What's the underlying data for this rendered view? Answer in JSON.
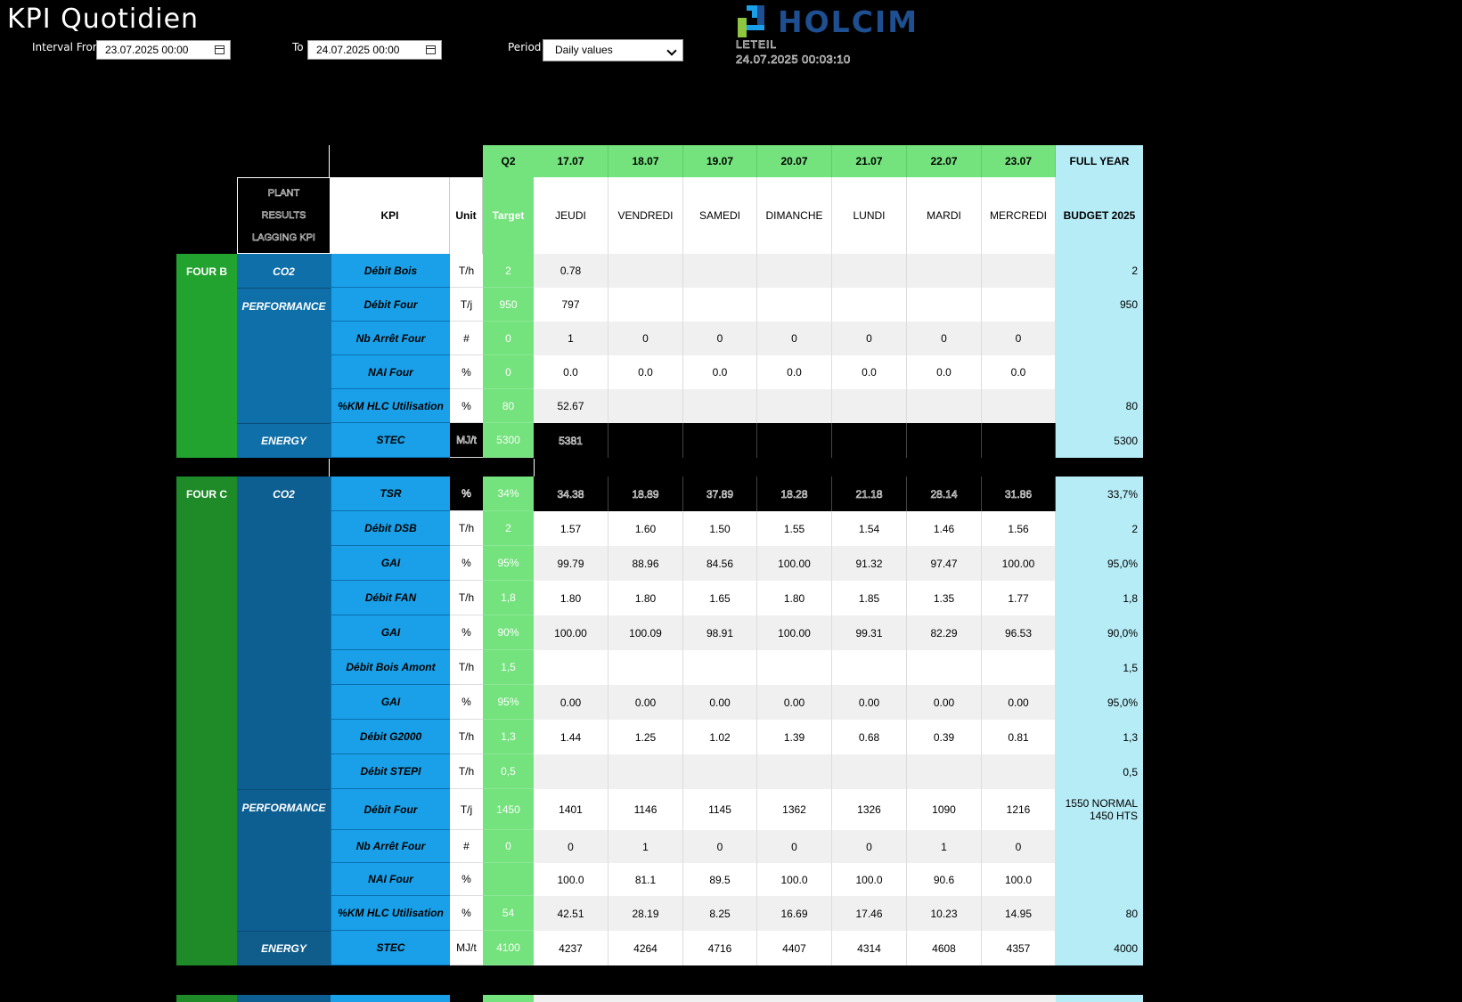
{
  "header": {
    "title": "KPI Quotidien",
    "interval_from_label": "Interval From",
    "interval_from_value": "23.07.2025 00:00",
    "to_label": "To",
    "to_value": "24.07.2025 00:00",
    "period_label": "Period",
    "period_value": "Daily values",
    "brand": "HOLCIM",
    "site": "LETEIL",
    "timestamp": "24.07.2025 00:03:10"
  },
  "table": {
    "top_headers": [
      "Q2",
      "17.07",
      "18.07",
      "19.07",
      "20.07",
      "21.07",
      "22.07",
      "23.07",
      "FULL YEAR"
    ],
    "plant_header": [
      "PLANT",
      "RESULTS",
      "LAGGING KPI"
    ],
    "kpi_header": "KPI",
    "unit_header": "Unit",
    "target_header": "Target",
    "day_names": [
      "JEUDI",
      "VENDREDI",
      "SAMEDI",
      "DIMANCHE",
      "LUNDI",
      "MARDI",
      "MERCREDI"
    ],
    "budget_header": "BUDGET 2025",
    "sections": [
      {
        "name": "FOUR B",
        "groups": [
          {
            "category": "CO2",
            "rows": [
              0
            ]
          },
          {
            "category": "PERFORMANCE",
            "rows": [
              1,
              2,
              3,
              4
            ]
          },
          {
            "category": "ENERGY",
            "rows": [
              5
            ]
          }
        ],
        "rows": [
          {
            "kpi": "Débit Bois",
            "unit": "T/h",
            "target": "2",
            "values": [
              "0.78",
              "",
              "",
              "",
              "",
              "",
              ""
            ],
            "budget": "2"
          },
          {
            "kpi": "Débit Four",
            "unit": "T/j",
            "target": "950",
            "values": [
              "797",
              "",
              "",
              "",
              "",
              "",
              ""
            ],
            "budget": "950"
          },
          {
            "kpi": "Nb Arrêt Four",
            "unit": "#",
            "target": "0",
            "values": [
              "1",
              "0",
              "0",
              "0",
              "0",
              "0",
              "0"
            ],
            "budget": ""
          },
          {
            "kpi": "NAI Four",
            "unit": "%",
            "target": "0",
            "values": [
              "0.0",
              "0.0",
              "0.0",
              "0.0",
              "0.0",
              "0.0",
              "0.0"
            ],
            "budget": ""
          },
          {
            "kpi": "%KM  HLC Utilisation",
            "unit": "%",
            "target": "80",
            "values": [
              "52.67",
              "",
              "",
              "",
              "",
              "",
              ""
            ],
            "budget": "80"
          },
          {
            "kpi": "STEC",
            "unit": "MJ/t",
            "target": "5300",
            "values": [
              "5381",
              "",
              "",
              "",
              "",
              "",
              ""
            ],
            "budget": "5300",
            "dark": true
          }
        ]
      },
      {
        "name": "FOUR C",
        "groups": [
          {
            "category": "CO2",
            "rows": [
              0,
              1,
              2,
              3,
              4,
              5,
              6,
              7,
              8
            ]
          },
          {
            "category": "PERFORMANCE",
            "rows": [
              9,
              10,
              11,
              12
            ]
          },
          {
            "category": "ENERGY",
            "rows": [
              13
            ]
          }
        ],
        "rows": [
          {
            "kpi": "TSR",
            "unit": "%",
            "target": "34%",
            "values": [
              "34.38",
              "18.89",
              "37.89",
              "18.28",
              "21.18",
              "28.14",
              "31.86"
            ],
            "budget": "33,7%",
            "dark": true
          },
          {
            "kpi": "Débit DSB",
            "unit": "T/h",
            "target": "2",
            "values": [
              "1.57",
              "1.60",
              "1.50",
              "1.55",
              "1.54",
              "1.46",
              "1.56"
            ],
            "budget": "2"
          },
          {
            "kpi": "GAI",
            "unit": "%",
            "target": "95%",
            "values": [
              "99.79",
              "88.96",
              "84.56",
              "100.00",
              "91.32",
              "97.47",
              "100.00"
            ],
            "budget": "95,0%"
          },
          {
            "kpi": "Débit FAN",
            "unit": "T/h",
            "target": "1,8",
            "values": [
              "1.80",
              "1.80",
              "1.65",
              "1.80",
              "1.85",
              "1.35",
              "1.77"
            ],
            "budget": "1,8"
          },
          {
            "kpi": "GAI",
            "unit": "%",
            "target": "90%",
            "values": [
              "100.00",
              "100.09",
              "98.91",
              "100.00",
              "99.31",
              "82.29",
              "96.53"
            ],
            "budget": "90,0%"
          },
          {
            "kpi": "Débit Bois Amont",
            "unit": "T/h",
            "target": "1,5",
            "values": [
              "",
              "",
              "",
              "",
              "",
              "",
              ""
            ],
            "budget": "1,5"
          },
          {
            "kpi": "GAI",
            "unit": "%",
            "target": "95%",
            "values": [
              "0.00",
              "0.00",
              "0.00",
              "0.00",
              "0.00",
              "0.00",
              "0.00"
            ],
            "budget": "95,0%"
          },
          {
            "kpi": "Débit G2000",
            "unit": "T/h",
            "target": "1,3",
            "values": [
              "1.44",
              "1.25",
              "1.02",
              "1.39",
              "0.68",
              "0.39",
              "0.81"
            ],
            "budget": "1,3"
          },
          {
            "kpi": "Débit STEPI",
            "unit": "T/h",
            "target": "0,5",
            "values": [
              "",
              "",
              "",
              "",
              "",
              "",
              ""
            ],
            "budget": "0,5"
          },
          {
            "kpi": "Débit Four",
            "unit": "T/j",
            "target": "1450",
            "values": [
              "1401",
              "1146",
              "1145",
              "1362",
              "1326",
              "1090",
              "1216"
            ],
            "budget": "1550 NORMAL\n1450 HTS"
          },
          {
            "kpi": "Nb Arrêt Four",
            "unit": "#",
            "target": "0",
            "values": [
              "0",
              "1",
              "0",
              "0",
              "0",
              "1",
              "0"
            ],
            "budget": ""
          },
          {
            "kpi": "NAI Four",
            "unit": "%",
            "target": "",
            "values": [
              "100.0",
              "81.1",
              "89.5",
              "100.0",
              "100.0",
              "90.6",
              "100.0"
            ],
            "budget": ""
          },
          {
            "kpi": "%KM  HLC Utilisation",
            "unit": "%",
            "target": "54",
            "values": [
              "42.51",
              "28.19",
              "8.25",
              "16.69",
              "17.46",
              "10.23",
              "14.95"
            ],
            "budget": "80"
          },
          {
            "kpi": "STEC",
            "unit": "MJ/t",
            "target": "4100",
            "values": [
              "4237",
              "4264",
              "4716",
              "4407",
              "4314",
              "4608",
              "4357"
            ],
            "budget": "4000"
          }
        ]
      }
    ]
  },
  "colors": {
    "four_b": "#22a22e",
    "four_c": "#1e8a28",
    "category_b": "#0f6fa8",
    "category_c": "#0d5e91",
    "kpi": "#1aa0e8",
    "target": "#74e27d",
    "budget": "#b6ecf6",
    "row_alt": "#f0f0f0"
  }
}
